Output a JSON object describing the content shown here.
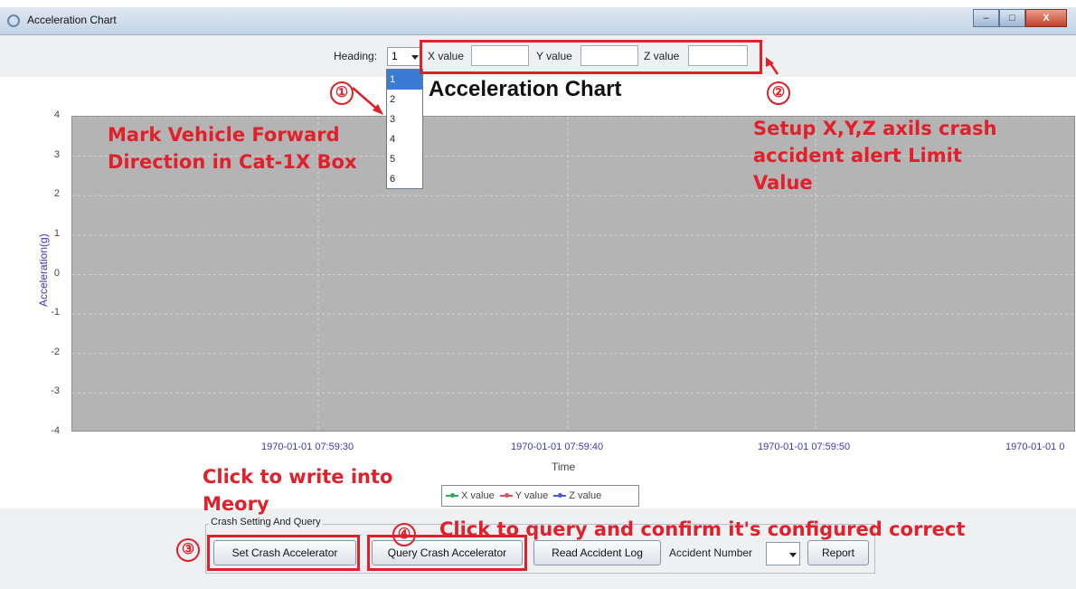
{
  "window": {
    "title": "Acceleration Chart",
    "controls": [
      "–",
      "□",
      "X"
    ]
  },
  "toolbar": {
    "heading_label": "Heading:",
    "heading_value": "1",
    "x_label": "X value",
    "y_label": "Y value",
    "z_label": "Z value",
    "x_value": "",
    "y_value": "",
    "z_value": ""
  },
  "heading_options": [
    "1",
    "2",
    "3",
    "4",
    "5",
    "6"
  ],
  "chart_data": {
    "type": "line",
    "title": "Acceleration Chart",
    "xlabel": "Time",
    "ylabel": "Acceleration(g)",
    "ylim": [
      -4,
      4
    ],
    "yticks": [
      "4",
      "3",
      "2",
      "1",
      "0",
      "-1",
      "-2",
      "-3",
      "-4"
    ],
    "xticks": [
      "1970-01-01 07:59:30",
      "1970-01-01 07:59:40",
      "1970-01-01 07:59:50",
      "1970-01-01 0"
    ],
    "series": [
      {
        "name": "X value",
        "color": "#2ea85a",
        "values": []
      },
      {
        "name": "Y value",
        "color": "#e0505a",
        "values": []
      },
      {
        "name": "Z value",
        "color": "#4a5ad0",
        "values": []
      }
    ],
    "grid": true,
    "legend": "bottom",
    "plot_background": "#b4b4b4"
  },
  "crash_group": {
    "title": "Crash Setting And Query",
    "set_button": "Set Crash Accelerator",
    "query_button": "Query Crash Accelerator",
    "read_log_button": "Read Accident Log",
    "accident_number_label": "Accident Number",
    "accident_number_value": "",
    "report_button": "Report"
  },
  "annotations": {
    "n1": "①",
    "n2": "②",
    "n3": "③",
    "n4": "④",
    "a1_line1": "Mark Vehicle Forward",
    "a1_line2": "Direction in Cat-1X Box",
    "a2_line1": "Setup X,Y,Z axils crash",
    "a2_line2": "accident alert Limit",
    "a2_line3": "Value",
    "a3_line1": "Click to write into",
    "a3_line2": "Meory",
    "a4": "Click to query and confirm it's configured correct"
  }
}
